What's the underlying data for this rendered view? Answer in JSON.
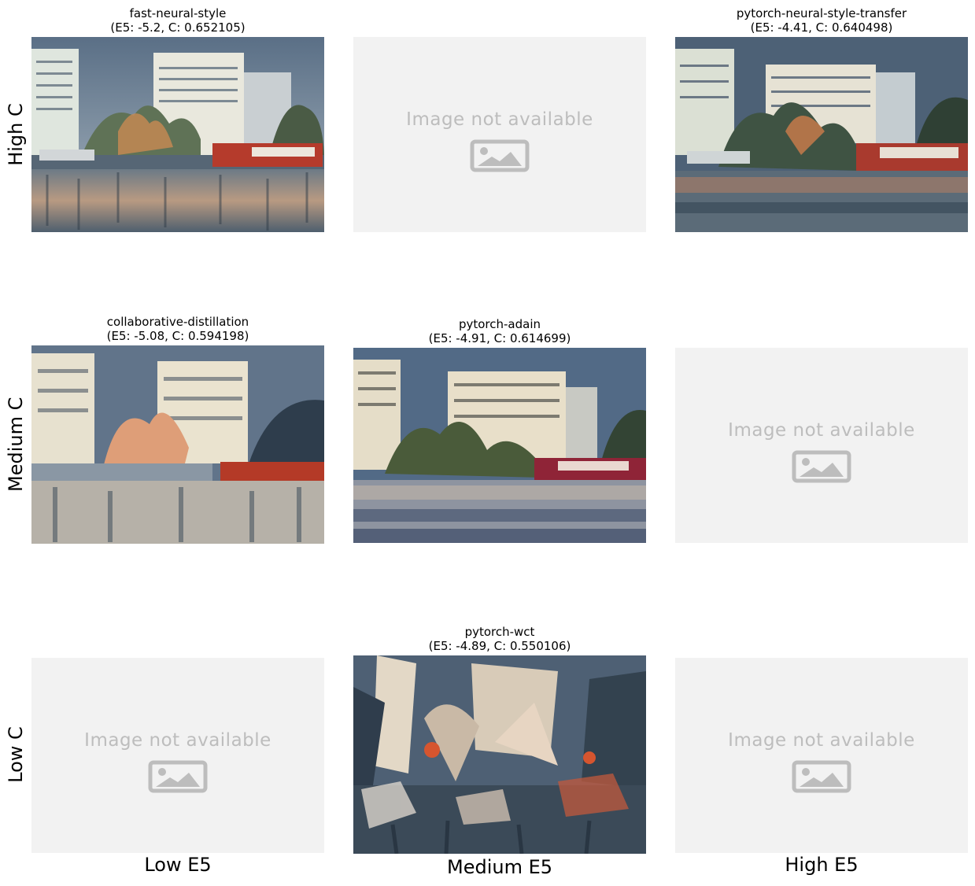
{
  "row_labels": [
    "High C",
    "Medium C",
    "Low C"
  ],
  "col_labels": [
    "Low E5",
    "Medium E5",
    "High E5"
  ],
  "placeholder_text": "Image not available",
  "cells": [
    {
      "row": "High C",
      "col": "Low E5",
      "method": "fast-neural-style",
      "metrics": "(E5: -5.2, C: 0.652105)",
      "available": true
    },
    {
      "row": "High C",
      "col": "Medium E5",
      "available": false
    },
    {
      "row": "High C",
      "col": "High E5",
      "method": "pytorch-neural-style-transfer",
      "metrics": "(E5: -4.41, C: 0.640498)",
      "available": true
    },
    {
      "row": "Medium C",
      "col": "Low E5",
      "method": "collaborative-distillation",
      "metrics": "(E5: -5.08, C: 0.594198)",
      "available": true
    },
    {
      "row": "Medium C",
      "col": "Medium E5",
      "method": "pytorch-adain",
      "metrics": "(E5: -4.91, C: 0.614699)",
      "available": true
    },
    {
      "row": "Medium C",
      "col": "High E5",
      "available": false
    },
    {
      "row": "Low C",
      "col": "Low E5",
      "available": false
    },
    {
      "row": "Low C",
      "col": "Medium E5",
      "method": "pytorch-wct",
      "metrics": "(E5: -4.89, C: 0.550106)",
      "available": true
    },
    {
      "row": "Low C",
      "col": "High E5",
      "available": false
    }
  ],
  "icons": [
    "image-placeholder-icon"
  ],
  "colors": {
    "placeholder_bg": "#f2f2f2",
    "placeholder_fg": "#bdbdbd"
  }
}
